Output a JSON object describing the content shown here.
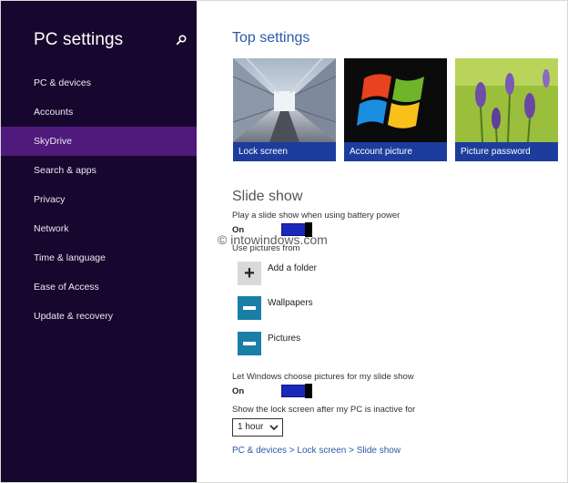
{
  "sidebar": {
    "title": "PC settings",
    "search_icon": "search-icon",
    "items": [
      {
        "label": "PC & devices",
        "selected": false
      },
      {
        "label": "Accounts",
        "selected": false
      },
      {
        "label": "SkyDrive",
        "selected": true
      },
      {
        "label": "Search & apps",
        "selected": false
      },
      {
        "label": "Privacy",
        "selected": false
      },
      {
        "label": "Network",
        "selected": false
      },
      {
        "label": "Time & language",
        "selected": false
      },
      {
        "label": "Ease of Access",
        "selected": false
      },
      {
        "label": "Update & recovery",
        "selected": false
      }
    ],
    "bg_color": "#17072e",
    "selected_color": "#4f1a7c"
  },
  "main": {
    "top_heading": "Top settings",
    "tiles": [
      {
        "label": "Lock screen",
        "image": "subway-train-photo"
      },
      {
        "label": "Account picture",
        "image": "windows-logo"
      },
      {
        "label": "Picture password",
        "image": "lavender-flowers-photo"
      }
    ],
    "slideshow": {
      "heading": "Slide show",
      "battery_label": "Play a slide show when using battery power",
      "battery_state": "On",
      "pictures_label": "Use pictures from",
      "add_folder": "Add a folder",
      "folders": [
        "Wallpapers",
        "Pictures"
      ],
      "choose_label": "Let Windows choose pictures for my slide show",
      "choose_state": "On",
      "inactive_label": "Show the lock screen after my PC is inactive for",
      "inactive_value": "1 hour"
    },
    "breadcrumb": "PC & devices > Lock screen > Slide show",
    "watermark": "© intowindows.com",
    "accent_color": "#2b5aa8",
    "tile_caption_color": "#1c3d9e",
    "toggle_color": "#1a27b8"
  }
}
